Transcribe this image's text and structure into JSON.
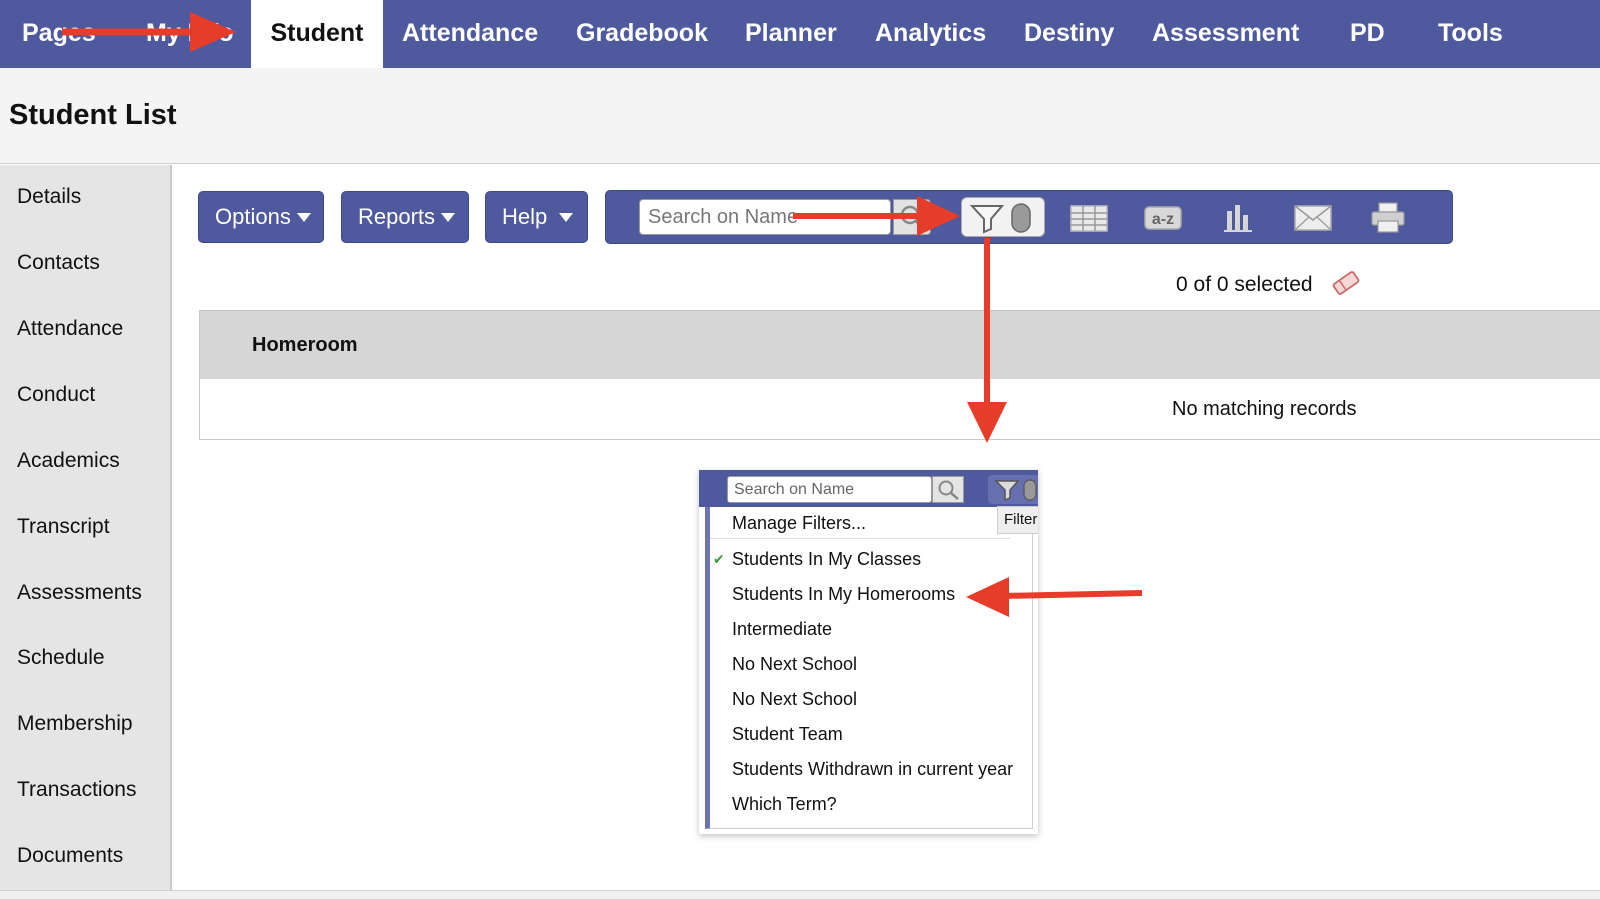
{
  "nav": {
    "tabs": [
      {
        "label": "Pages"
      },
      {
        "label": "My Info"
      },
      {
        "label": "Student"
      },
      {
        "label": "Attendance"
      },
      {
        "label": "Gradebook"
      },
      {
        "label": "Planner"
      },
      {
        "label": "Analytics"
      },
      {
        "label": "Destiny"
      },
      {
        "label": "Assessment"
      },
      {
        "label": "PD"
      },
      {
        "label": "Tools"
      }
    ]
  },
  "page_title": "Student List",
  "sidebar": {
    "items": [
      {
        "label": "Details"
      },
      {
        "label": "Contacts"
      },
      {
        "label": "Attendance"
      },
      {
        "label": "Conduct"
      },
      {
        "label": "Academics"
      },
      {
        "label": "Transcript"
      },
      {
        "label": "Assessments"
      },
      {
        "label": "Schedule"
      },
      {
        "label": "Membership"
      },
      {
        "label": "Transactions"
      },
      {
        "label": "Documents"
      }
    ]
  },
  "toolbar": {
    "options_label": "Options",
    "reports_label": "Reports",
    "help_label": "Help",
    "search_placeholder": "Search on Name",
    "icons": [
      "search-icon",
      "filter-icon",
      "table-view-icon",
      "sort-az-icon",
      "chart-icon",
      "mail-icon",
      "print-icon"
    ]
  },
  "selection": {
    "text": "0 of 0 selected",
    "icon": "eraser-icon"
  },
  "table": {
    "columns": [
      "Homeroom"
    ],
    "empty_text": "No matching records"
  },
  "filter_menu": {
    "search_placeholder": "Search on Name",
    "tooltip": "Filter",
    "manage_label": "Manage Filters...",
    "items": [
      {
        "label": "Students In My Classes",
        "checked": true
      },
      {
        "label": "Students In My Homerooms",
        "checked": false
      },
      {
        "label": "Intermediate",
        "checked": false
      },
      {
        "label": "No Next School",
        "checked": false
      },
      {
        "label": "No Next School",
        "checked": false
      },
      {
        "label": "Student Team",
        "checked": false
      },
      {
        "label": "Students Withdrawn in current year",
        "checked": false
      },
      {
        "label": "Which Term?",
        "checked": false
      }
    ]
  },
  "colors": {
    "nav_bg": "#4f5a9e",
    "annotation_arrow": "#e63c2a"
  }
}
